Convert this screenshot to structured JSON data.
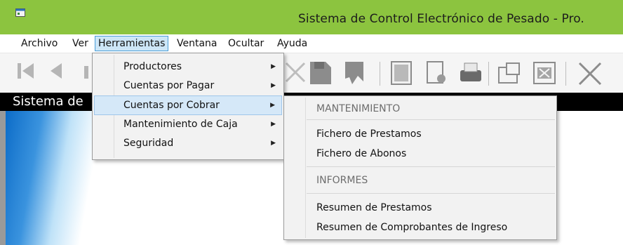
{
  "window": {
    "title": "Sistema de Control Electrónico de Pesado - Pro."
  },
  "menubar": [
    "Archivo",
    "Ver",
    "Herramientas",
    "Ventana",
    "Ocultar",
    "Ayuda"
  ],
  "status_bar_text": "Sistema de",
  "herramientas_menu": {
    "items": [
      {
        "label": "Productores"
      },
      {
        "label": "Cuentas por Pagar"
      },
      {
        "label": "Cuentas por Cobrar"
      },
      {
        "label": "Mantenimiento de Caja"
      },
      {
        "label": "Seguridad"
      }
    ],
    "highlighted": "Cuentas por Cobrar"
  },
  "cuentas_por_cobrar_submenu": {
    "sections": [
      {
        "header": "MANTENIMIENTO",
        "items": [
          "Fichero de Prestamos",
          "Fichero de Abonos"
        ]
      },
      {
        "header": "INFORMES",
        "items": [
          "Resumen de Prestamos",
          "Resumen de Comprobantes de Ingreso"
        ]
      }
    ]
  },
  "toolbar_icons": [
    "first-record-icon",
    "previous-record-icon",
    "delete-icon",
    "save-icon",
    "undo-icon",
    "find-icon",
    "preview-icon",
    "print-icon",
    "export-icon",
    "excel-icon",
    "close-icon"
  ],
  "colors": {
    "titlebar": "#8cc43f",
    "menu_highlight": "#d5e8f8",
    "active_menu": "#cde6f7"
  }
}
